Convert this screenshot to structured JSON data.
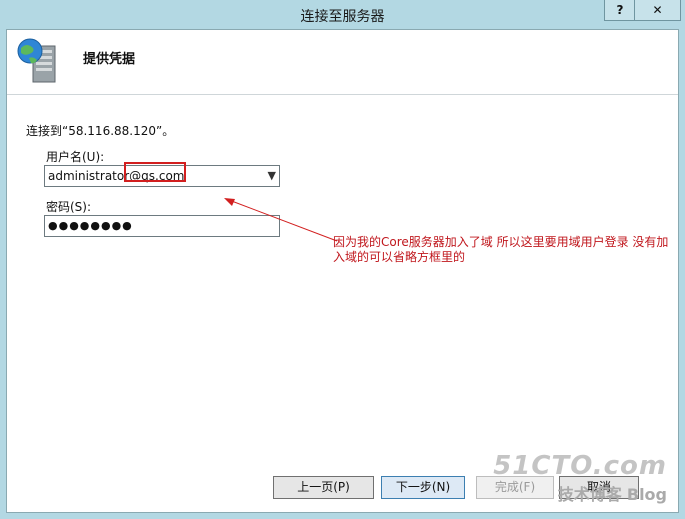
{
  "window": {
    "title": "连接至服务器",
    "help_label": "?",
    "close_label": "✕"
  },
  "header": {
    "title": "提供凭据",
    "icon": "server-globe-icon"
  },
  "content": {
    "connect_text": "连接到“58.116.88.120”。",
    "username_label": "用户名(U):",
    "username_value": "administrator@qs.com",
    "password_label": "密码(S):",
    "password_value": "●●●●●●●●",
    "note": "因为我的Core服务器加入了域 所以这里要用域用户登录 没有加入域的可以省略方框里的"
  },
  "footer": {
    "back_label": "上一页(P)",
    "next_label": "下一步(N)",
    "finish_label": "完成(F)",
    "cancel_label": "取消"
  },
  "watermark": {
    "site": "51CTO.com",
    "subtitle": "技术博客",
    "blog": "Blog"
  },
  "colors": {
    "annotation": "#d21f1f",
    "window_frame": "#b3d8e3"
  }
}
